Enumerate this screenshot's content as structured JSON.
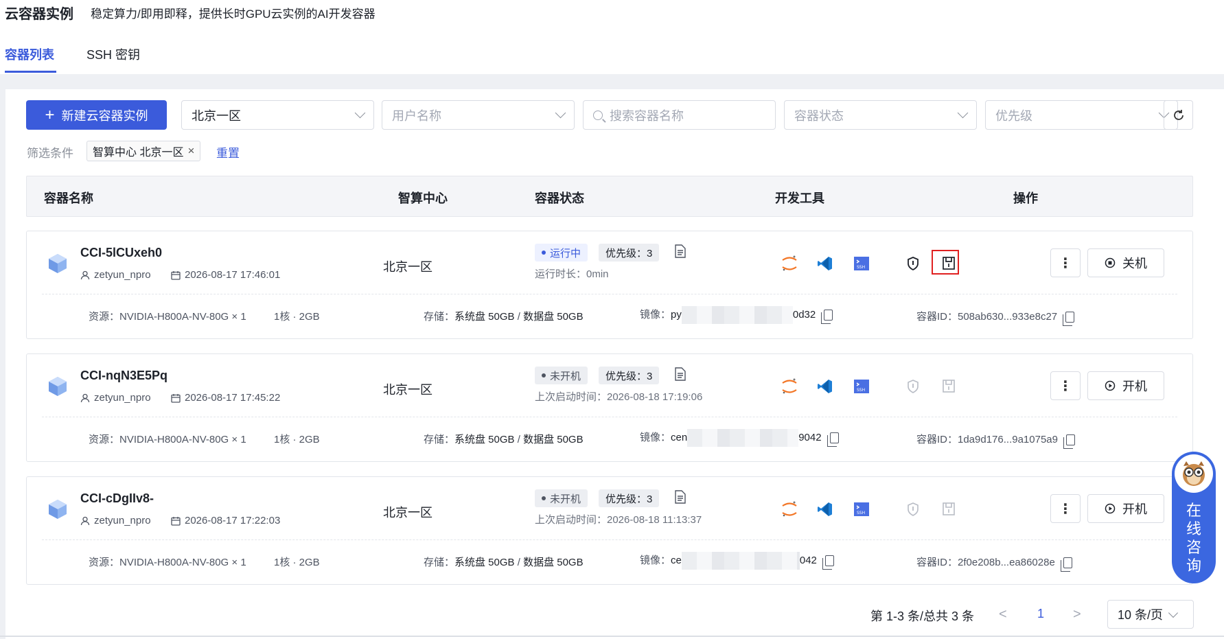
{
  "header": {
    "title": "云容器实例",
    "subtitle": "稳定算力/即用即释，提供长时GPU云实例的AI开发容器",
    "tabs": [
      {
        "label": "容器列表",
        "active": true
      },
      {
        "label": "SSH 密钥",
        "active": false
      }
    ]
  },
  "toolbar": {
    "new_button": "新建云容器实例",
    "region_select": "北京一区",
    "user_placeholder": "用户名称",
    "search_placeholder": "搜索容器名称",
    "status_placeholder": "容器状态",
    "priority_placeholder": "优先级"
  },
  "filter": {
    "label": "筛选条件",
    "chip": "智算中心 北京一区",
    "reset": "重置"
  },
  "table": {
    "columns": [
      "容器名称",
      "智算中心",
      "容器状态",
      "开发工具",
      "操作"
    ]
  },
  "rows": [
    {
      "name": "CCI-5lCUxeh0",
      "user": "zetyun_npro",
      "created": "2026-08-17 17:46:01",
      "center": "北京一区",
      "status": "运行中",
      "priority": "优先级：3",
      "runline": "运行时长：0min",
      "power_label": "关机",
      "resource": "资源：NVIDIA-H800A-NV-80G × 1",
      "cores": "1核 · 2GB",
      "storage_label": "存储：",
      "storage_sys": "系统盘 50GB",
      "storage_sep": "/",
      "storage_data": "数据盘 50GB",
      "image_label": "镜像：",
      "image_prefix": "py",
      "image_suffix": "0d32",
      "container_id": "容器ID：508ab630...933e8c27"
    },
    {
      "name": "CCI-nqN3E5Pq",
      "user": "zetyun_npro",
      "created": "2026-08-17 17:45:22",
      "center": "北京一区",
      "status": "未开机",
      "priority": "优先级：3",
      "runline": "上次启动时间：2026-08-18 17:19:06",
      "power_label": "开机",
      "resource": "资源：NVIDIA-H800A-NV-80G × 1",
      "cores": "1核 · 2GB",
      "storage_label": "存储：",
      "storage_sys": "系统盘 50GB",
      "storage_sep": "/",
      "storage_data": "数据盘 50GB",
      "image_label": "镜像：",
      "image_prefix": "cen",
      "image_suffix": "9042",
      "container_id": "容器ID：1da9d176...9a1075a9"
    },
    {
      "name": "CCI-cDgIIv8-",
      "user": "zetyun_npro",
      "created": "2026-08-17 17:22:03",
      "center": "北京一区",
      "status": "未开机",
      "priority": "优先级：3",
      "runline": "上次启动时间：2026-08-18 11:13:37",
      "power_label": "开机",
      "resource": "资源：NVIDIA-H800A-NV-80G × 1",
      "cores": "1核 · 2GB",
      "storage_label": "存储：",
      "storage_sys": "系统盘 50GB",
      "storage_sep": "/",
      "storage_data": "数据盘 50GB",
      "image_label": "镜像：",
      "image_prefix": "ce",
      "image_suffix": "042",
      "container_id": "容器ID：2f0e208b...ea86028e"
    }
  ],
  "pagination": {
    "summary": "第 1-3 条/总共 3 条",
    "prev": "<",
    "current": "1",
    "next": ">",
    "page_size": "10 条/页"
  },
  "consult": {
    "chars": [
      "在",
      "线",
      "咨",
      "询"
    ]
  },
  "colors": {
    "primary": "#3b5bdb",
    "highlight_box": "#e02020",
    "consult_bg": "#3b67e0"
  }
}
